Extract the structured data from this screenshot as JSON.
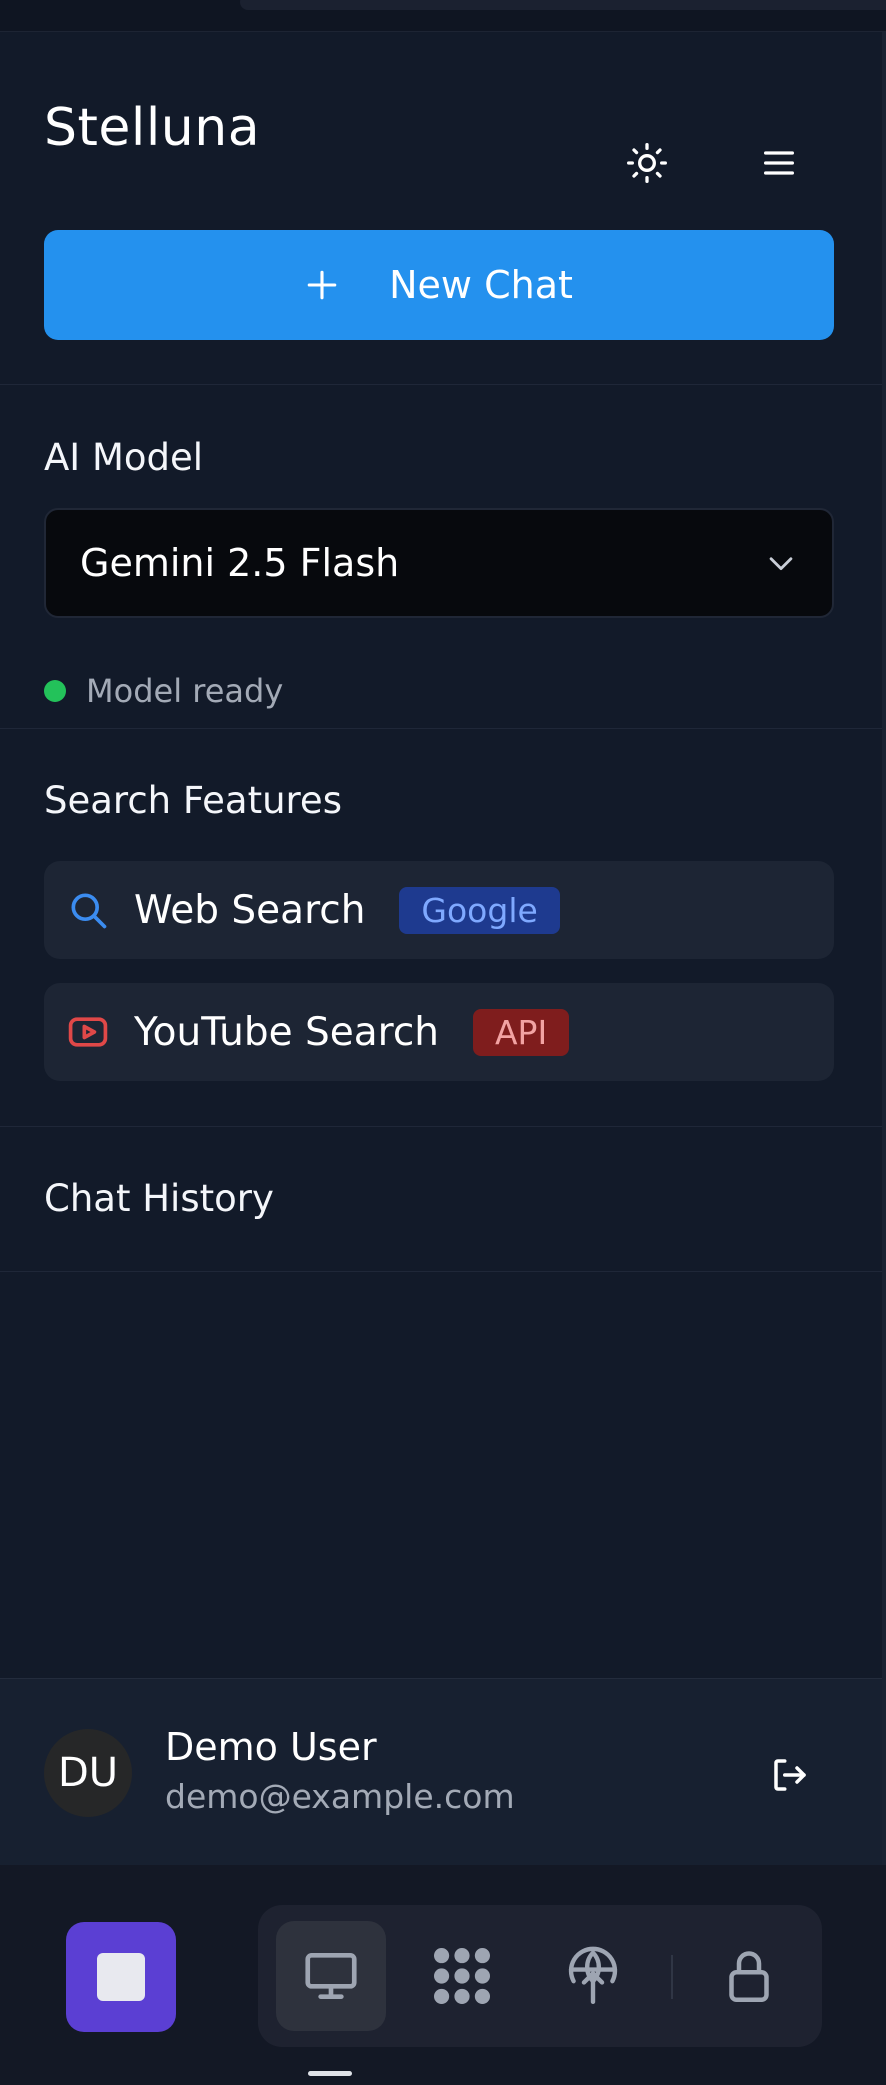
{
  "app": {
    "title": "Stelluna"
  },
  "actions": {
    "new_chat": "New Chat"
  },
  "model": {
    "section_title": "AI Model",
    "selected": "Gemini 2.5 Flash",
    "status": "Model ready",
    "status_color": "#23c25a"
  },
  "search": {
    "section_title": "Search Features",
    "items": [
      {
        "label": "Web Search",
        "badge": "Google",
        "icon": "search-icon"
      },
      {
        "label": "YouTube Search",
        "badge": "API",
        "icon": "youtube-icon"
      }
    ]
  },
  "history": {
    "section_title": "Chat History"
  },
  "user": {
    "initials": "DU",
    "name": "Demo User",
    "email": "demo@example.com"
  },
  "colors": {
    "accent": "#2491ee",
    "stop_button": "#5b3fd3",
    "background": "#121a29"
  },
  "dock": {
    "items": [
      "monitor-icon",
      "apps-icon",
      "globe-upload-icon",
      "lock-icon"
    ]
  }
}
